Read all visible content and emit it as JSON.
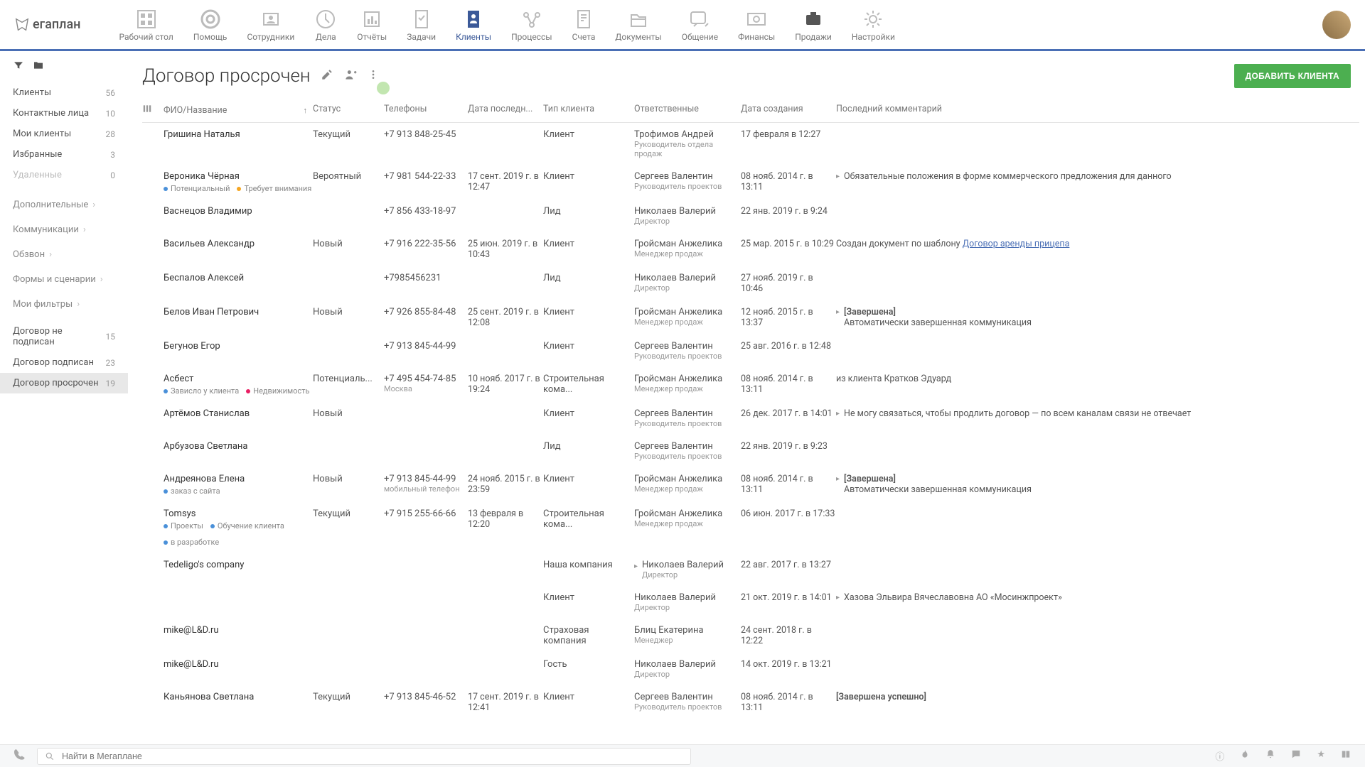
{
  "logo": "егаплан",
  "nav": [
    {
      "label": "Рабочий стол"
    },
    {
      "label": "Помощь"
    },
    {
      "label": "Сотрудники"
    },
    {
      "label": "Дела"
    },
    {
      "label": "Отчёты"
    },
    {
      "label": "Задачи"
    },
    {
      "label": "Клиенты"
    },
    {
      "label": "Процессы"
    },
    {
      "label": "Счета"
    },
    {
      "label": "Документы"
    },
    {
      "label": "Общение"
    },
    {
      "label": "Финансы"
    },
    {
      "label": "Продажи"
    },
    {
      "label": "Настройки"
    }
  ],
  "sidebar": {
    "items": [
      {
        "label": "Клиенты",
        "count": "56"
      },
      {
        "label": "Контактные лица",
        "count": "10"
      },
      {
        "label": "Мои клиенты",
        "count": "28"
      },
      {
        "label": "Избранные",
        "count": "3"
      },
      {
        "label": "Удаленные",
        "count": "0"
      }
    ],
    "sections": [
      {
        "label": "Дополнительные"
      },
      {
        "label": "Коммуникации"
      },
      {
        "label": "Обзвон"
      },
      {
        "label": "Формы и сценарии"
      },
      {
        "label": "Мои фильтры"
      }
    ],
    "filters": [
      {
        "label": "Договор не подписан",
        "count": "15"
      },
      {
        "label": "Договор подписан",
        "count": "23"
      },
      {
        "label": "Договор просрочен",
        "count": "19"
      }
    ]
  },
  "page_title": "Договор просрочен",
  "add_client": "ДОБАВИТЬ КЛИЕНТА",
  "columns": {
    "name": "ФИО/Название",
    "status": "Статус",
    "phone": "Телефоны",
    "last": "Дата последн...",
    "type": "Тип клиента",
    "resp": "Ответственные",
    "created": "Дата создания",
    "comment": "Последний комментарий"
  },
  "rows": [
    {
      "name": "Гришина Наталья",
      "status": "Текущий",
      "phone": "+7 913 848-25-45",
      "type": "Клиент",
      "resp": "Трофимов Андрей",
      "role": "Руководитель отдела продаж",
      "created": "17 февраля в 12:27"
    },
    {
      "name": "Вероника Чёрная",
      "tags": [
        {
          "c": "blue",
          "t": "Потенциальный"
        },
        {
          "c": "orange",
          "t": "Требует внимания"
        }
      ],
      "status": "Вероятный",
      "phone": "+7 981 544-22-33",
      "date": "17 сент. 2019 г. в 12:47",
      "type": "Клиент",
      "resp": "Сергеев Валентин",
      "role": "Руководитель проектов",
      "created": "08 нояб. 2014 г. в 13:11",
      "comment": "Обязательные положения в форме коммерческого предложения для данного",
      "caret": true
    },
    {
      "name": "Васнецов Владимир",
      "phone": "+7 856 433-18-97",
      "type": "Лид",
      "resp": "Николаев Валерий",
      "role": "Директор",
      "created": "22 янв. 2019 г. в 9:24"
    },
    {
      "name": "Васильев Александр",
      "status": "Новый",
      "phone": "+7 916 222-35-56",
      "date": "25 июн. 2019 г. в 10:43",
      "type": "Клиент",
      "resp": "Гройсман Анжелика",
      "role": "Менеджер продаж",
      "created": "25 мар. 2015 г. в 10:29",
      "comment_prefix": "Создан документ по шаблону ",
      "comment_link": "Договор аренды прицепа"
    },
    {
      "name": "Беспалов Алексей",
      "phone": "+7985456231",
      "type": "Лид",
      "resp": "Николаев Валерий",
      "role": "Директор",
      "created": "27 нояб. 2019 г. в 10:46"
    },
    {
      "name": "Белов Иван Петрович",
      "status": "Новый",
      "phone": "+7 926 855-84-48",
      "date": "25 сент. 2019 г. в 12:08",
      "type": "Клиент",
      "resp": "Гройсман Анжелика",
      "role": "Менеджер продаж",
      "created": "12 нояб. 2015 г. в 13:37",
      "comment_bold": "[Завершена]",
      "comment": "Автоматически завершенная коммуникация",
      "caret": true
    },
    {
      "name": "Бегунов Егор",
      "phone": "+7 913 845-44-99",
      "type": "Клиент",
      "resp": "Сергеев Валентин",
      "role": "Руководитель проектов",
      "created": "25 авг. 2016 г. в 12:48"
    },
    {
      "name": "Асбест",
      "tags": [
        {
          "c": "blue",
          "t": "Зависло у клиента"
        },
        {
          "c": "pink",
          "t": "Недвижимость"
        }
      ],
      "status": "Потенциаль...",
      "phone": "+7 495 454-74-85",
      "phone_sub": "Москва",
      "date": "10 нояб. 2017 г. в 19:24",
      "type": "Строительная кома...",
      "resp": "Гройсман Анжелика",
      "role": "Менеджер продаж",
      "created": "08 нояб. 2014 г. в 13:11",
      "comment": "из клиента Кратков Эдуард"
    },
    {
      "name": "Артёмов Станислав",
      "status": "Новый",
      "type": "Клиент",
      "resp": "Сергеев Валентин",
      "role": "Руководитель проектов",
      "created": "26 дек. 2017 г. в 14:01",
      "comment": "Не могу связаться, чтобы продлить договор — по всем каналам связи не отвечает",
      "caret": true
    },
    {
      "name": "Арбузова Светлана",
      "type": "Лид",
      "resp": "Сергеев Валентин",
      "role": "Руководитель проектов",
      "created": "22 янв. 2019 г. в 9:23"
    },
    {
      "name": "Андреянова Елена",
      "tags": [
        {
          "c": "blue",
          "t": "заказ с сайта"
        }
      ],
      "status": "Новый",
      "phone": "+7 913 845-44-99",
      "phone_sub": "мобильный телефон",
      "date": "24 нояб. 2015 г. в 23:59",
      "type": "Клиент",
      "resp": "Гройсман Анжелика",
      "role": "Менеджер продаж",
      "created": "08 нояб. 2014 г. в 13:11",
      "comment_bold": "[Завершена]",
      "comment": "Автоматически завершенная коммуникация",
      "caret": true
    },
    {
      "name": "Tomsys",
      "tags": [
        {
          "c": "blue",
          "t": "Проекты"
        },
        {
          "c": "blue",
          "t": "Обучение клиента"
        },
        {
          "c": "blue",
          "t": "в разработке"
        }
      ],
      "status": "Текущий",
      "phone": "+7 915 255-66-66",
      "date": "13 февраля в 12:20",
      "type": "Строительная кома...",
      "resp": "Гройсман Анжелика",
      "role": "Менеджер продаж",
      "created": "06 июн. 2017 г. в 17:33"
    },
    {
      "name": "Tedeligo's company",
      "type": "Наша компания",
      "resp": "Николаев Валерий",
      "role": "Директор",
      "resp_caret": true,
      "created": "22 авг. 2017 г. в 13:27"
    },
    {
      "name": "",
      "type": "Клиент",
      "resp": "Николаев Валерий",
      "role": "Директор",
      "created": "21 окт. 2019 г. в 14:01",
      "comment": "Хазова Эльвира Вячеславовна  АО «Мосинжпроект»",
      "caret": true
    },
    {
      "name": "mike@L&D.ru",
      "type": "Страховая компания",
      "resp": "Блиц Екатерина",
      "role": "Менеджер",
      "created": "24 сент. 2018 г. в 12:22"
    },
    {
      "name": "mike@L&D.ru",
      "type": "Гость",
      "resp": "Николаев Валерий",
      "role": "Директор",
      "created": "14 окт. 2019 г. в 13:21"
    },
    {
      "name": "Каньянова Светлана",
      "status": "Текущий",
      "phone": "+7 913 845-46-52",
      "date": "17 сент. 2019 г. в 12:41",
      "type": "Клиент",
      "resp": "Сергеев Валентин",
      "role": "Руководитель проектов",
      "created": "08 нояб. 2014 г. в 13:11",
      "comment_bold": "[Завершена успешно]"
    }
  ],
  "search_placeholder": "Найти в Мегаплане"
}
